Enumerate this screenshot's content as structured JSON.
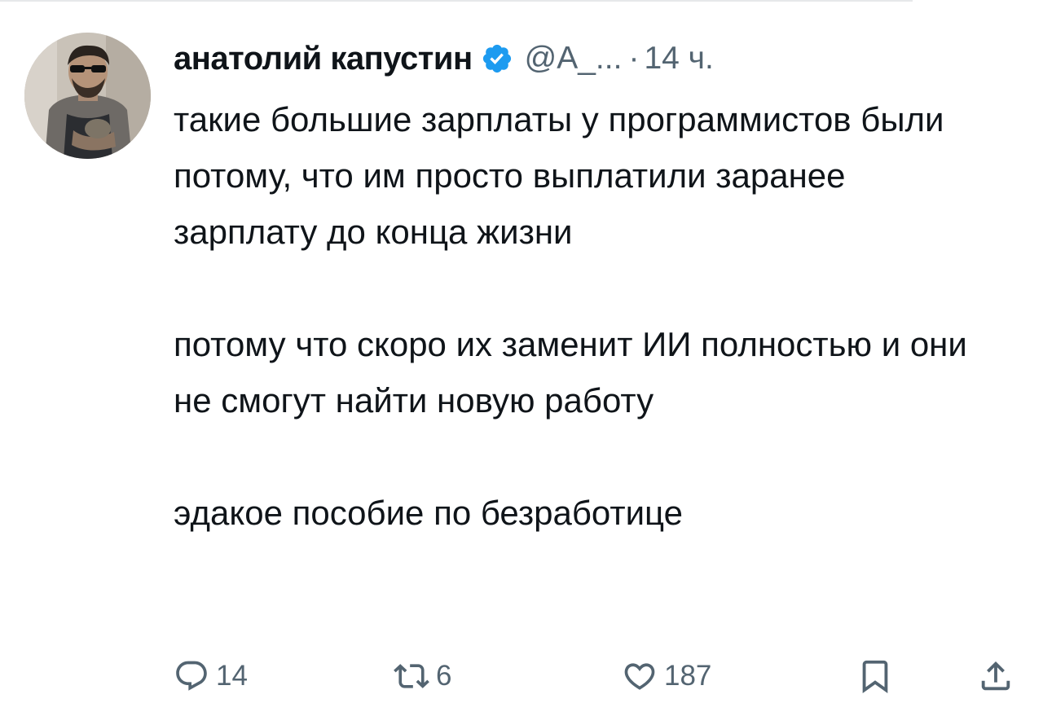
{
  "tweet": {
    "author_name": "анатолий капустин",
    "handle": "@A_...",
    "separator": "·",
    "time": "14 ч.",
    "paragraphs": [
      "такие большие зарплаты у программистов были потому, что им просто выплатили заранее зарплату до конца жизни",
      "потому что скоро их заменит ИИ полностью и они не смогут найти новую работу",
      "эдакое пособие по безработице"
    ],
    "verified_color": "#1d9bf0"
  },
  "actions": {
    "reply_count": "14",
    "retweet_count": "6",
    "like_count": "187"
  },
  "icons": {
    "reply": "reply-icon",
    "retweet": "retweet-icon",
    "like": "heart-icon",
    "bookmark": "bookmark-icon",
    "share": "share-icon"
  }
}
